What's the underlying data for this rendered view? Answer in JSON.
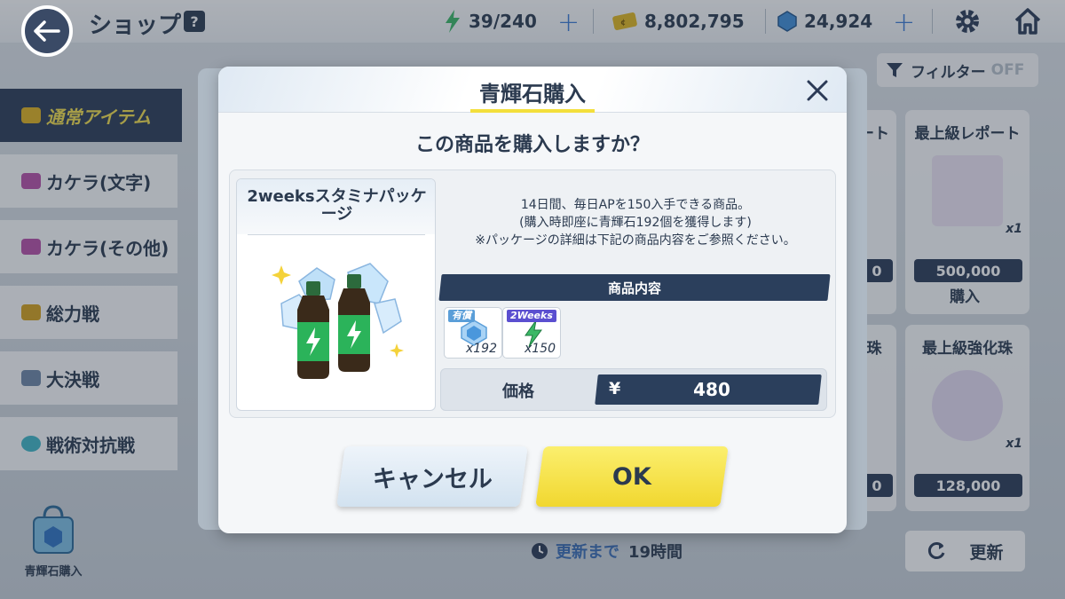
{
  "header": {
    "title": "ショップ",
    "help_label": "?",
    "ap": "39/240",
    "credits": "8,802,795",
    "pyroxene": "24,924"
  },
  "sidebar": {
    "items": [
      {
        "label": "通常アイテム"
      },
      {
        "label": "カケラ(文字)"
      },
      {
        "label": "カケラ(その他)"
      },
      {
        "label": "総力戦"
      },
      {
        "label": "大決戦"
      },
      {
        "label": "戦術対抗戦"
      }
    ],
    "shortcut_label": "青輝石購入"
  },
  "filter": {
    "label": "フィルター",
    "state": "OFF"
  },
  "background_cards": [
    {
      "title": "ート",
      "price": "0"
    },
    {
      "title": "最上級レポート",
      "qty": "x1",
      "price": "500,000",
      "action": "購入"
    },
    {
      "title": "珠",
      "price": "0"
    },
    {
      "title": "最上級強化珠",
      "qty": "x1",
      "price": "128,000"
    }
  ],
  "refresh": {
    "label": "更新まで",
    "time": "19時間",
    "button": "更新"
  },
  "dialog": {
    "title": "青輝石購入",
    "question": "この商品を購入しますか？",
    "package_name": "2weeksスタミナパッケージ",
    "description": [
      "14日間、毎日APを150入手できる商品。",
      "(購入時即座に青輝石192個を獲得します)",
      "※パッケージの詳細は下記の商品内容をご参照ください。"
    ],
    "contents_header": "商品内容",
    "items": [
      {
        "tag": "有償",
        "icon": "pyroxene-icon",
        "qty": "x192"
      },
      {
        "tag": "2Weeks",
        "icon": "ap-bolt-icon",
        "qty": "x150"
      }
    ],
    "price_label": "価格",
    "currency": "¥",
    "price": "480",
    "cancel_label": "キャンセル",
    "ok_label": "OK"
  },
  "colors": {
    "navy": "#2b3f5c",
    "ok_yellow": "#f1d72f",
    "accent_yellow": "#f3df3c",
    "blue_plus": "#3b7bd6"
  }
}
